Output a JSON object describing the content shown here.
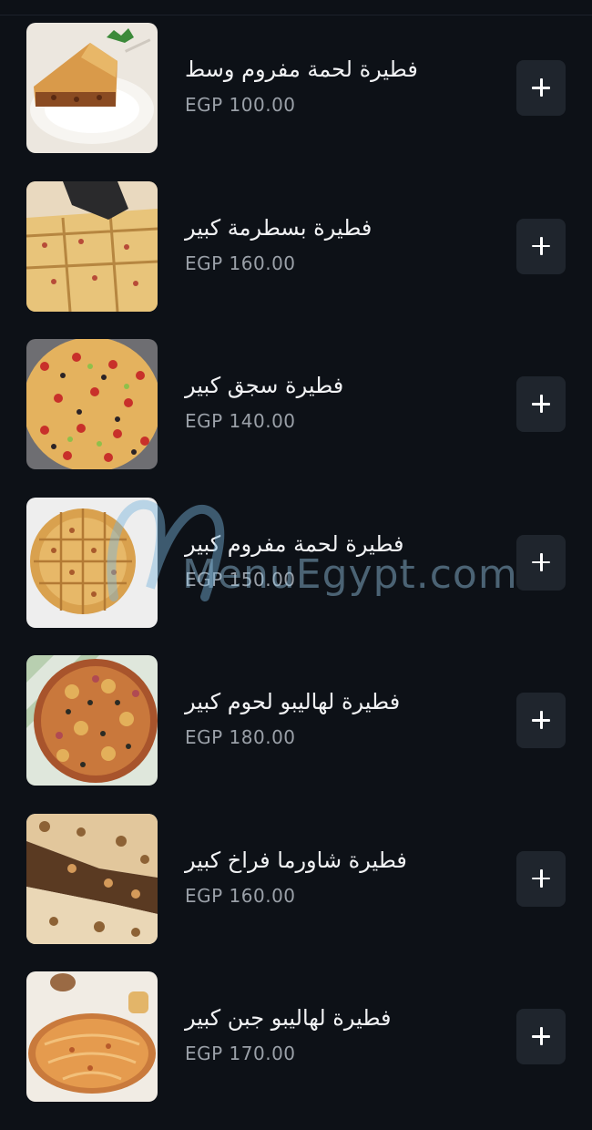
{
  "menu": {
    "items": [
      {
        "name": "فطيرة لحمة مفروم وسط",
        "price": "EGP 100.00",
        "image": "meat-pie-slice-image"
      },
      {
        "name": "فطيرة بسطرمة كبير",
        "price": "EGP 160.00",
        "image": "pastrami-pie-image"
      },
      {
        "name": "فطيرة سجق كبير",
        "price": "EGP 140.00",
        "image": "sausage-pie-image"
      },
      {
        "name": "فطيرة لحمة مفروم كبير",
        "price": "EGP 150.00",
        "image": "large-meat-pie-image"
      },
      {
        "name": "فطيرة لهاليبو لحوم كبير",
        "price": "EGP 180.00",
        "image": "halibo-meat-pie-image"
      },
      {
        "name": "فطيرة شاورما فراخ كبير",
        "price": "EGP 160.00",
        "image": "chicken-shawarma-pie-image"
      },
      {
        "name": "فطيرة لهاليبو جبن كبير",
        "price": "EGP 170.00",
        "image": "halibo-cheese-pie-image"
      }
    ],
    "add_icon": "plus-icon"
  },
  "watermark": {
    "text": "MenuEgypt.com"
  }
}
